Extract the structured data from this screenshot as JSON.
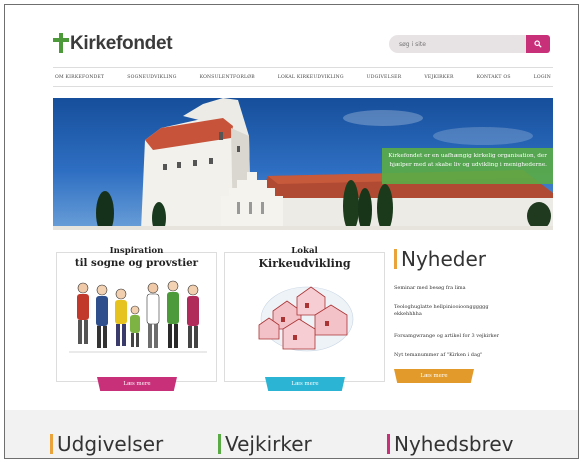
{
  "header": {
    "logo_text": "Kirkefondet",
    "search_placeholder": "søg i site"
  },
  "nav": {
    "items": [
      "Om Kirkefondet",
      "Sogneudvikling",
      "Konsulentforløb",
      "Lokal kirkeudvikling",
      "Udgivelser",
      "Vejkirker",
      "Kontakt os",
      "Login"
    ]
  },
  "hero": {
    "caption": "Kirkefondet er en uafhængig kirkelig organisation, der hjælper med at skabe liv og udvikling i menighederne."
  },
  "cards": [
    {
      "title_line1": "Inspiration",
      "title_line2": "til sogne og provstier",
      "button": "Læs mere",
      "button_color": "#c8307a"
    },
    {
      "title_line1": "Lokal",
      "title_line2": "Kirkeudvikling",
      "button": "Læs mere",
      "button_color": "#2bb4d4"
    }
  ],
  "news": {
    "title": "Nyheder",
    "items": [
      "Seminar med besøg fra lima",
      "Teologhuglatte hellpiniooioongggggg ekkehhhha",
      "Forsamgwrange og artikel for 3 vejkirker",
      "Nyt temanummer af \"Kirken i dag\""
    ],
    "button": "Læs mere",
    "accent": "#e9a33a"
  },
  "footer": {
    "sections": [
      {
        "title": "Udgivelser",
        "accent": "#e9a33a"
      },
      {
        "title": "Vejkirker",
        "accent": "#5aaa46"
      },
      {
        "title": "Nyhedsbrev",
        "accent": "#c8307a"
      }
    ]
  }
}
